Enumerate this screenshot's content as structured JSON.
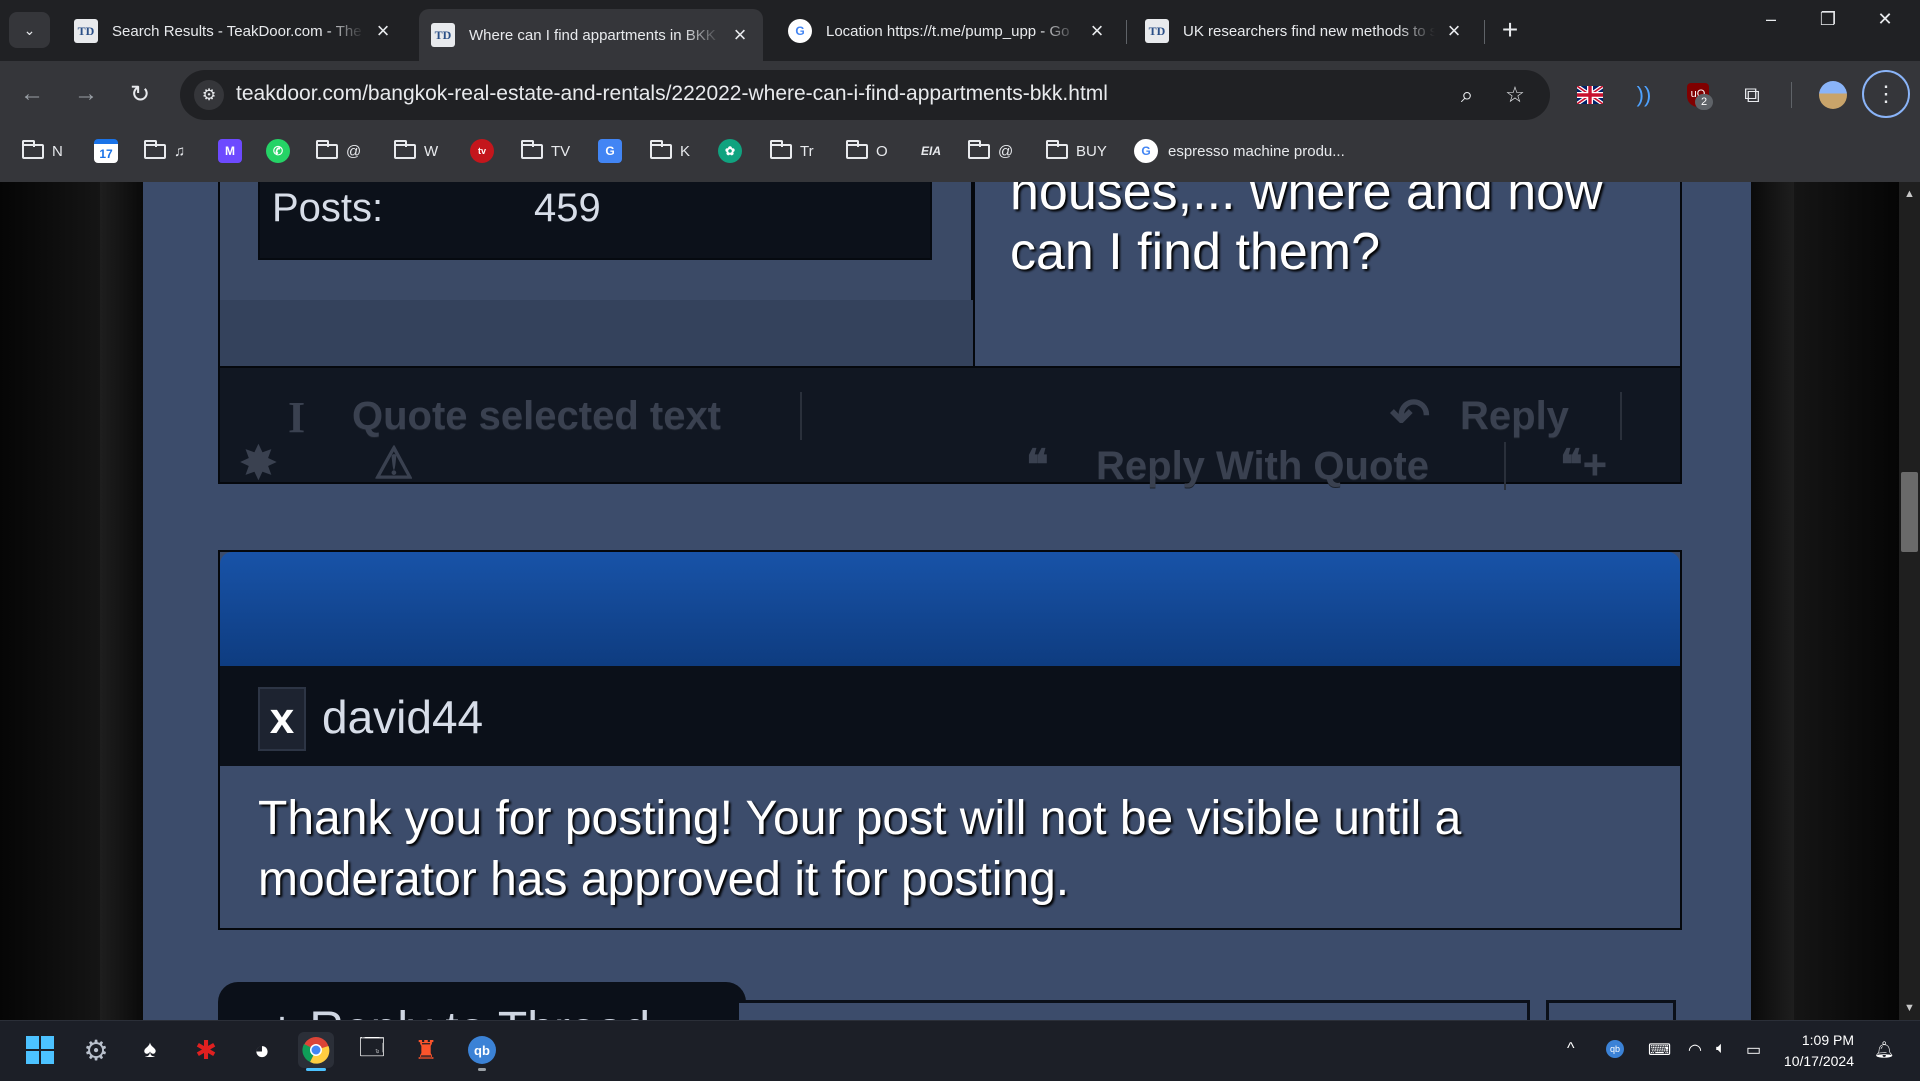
{
  "browser": {
    "tabs": [
      {
        "title": "Search Results - TeakDoor.com - The",
        "favicon": "teakdoor-favicon",
        "active": false
      },
      {
        "title": "Where can I find appartments in BKK ?",
        "favicon": "teakdoor-favicon",
        "active": true
      },
      {
        "title": "Location https://t.me/pump_upp - Go",
        "favicon": "google-favicon",
        "active": false
      },
      {
        "title": "UK researchers find new methods to s",
        "favicon": "teakdoor-favicon",
        "active": false
      }
    ],
    "url": "teakdoor.com/bangkok-real-estate-and-rentals/222022-where-can-i-find-appartments-bkk.html",
    "extension_badge": "2",
    "bookmarks": [
      {
        "label": "N",
        "icon": "folder-icon"
      },
      {
        "label": "",
        "icon": "calendar-icon",
        "text": "17"
      },
      {
        "label": "♫",
        "icon": "folder-icon"
      },
      {
        "label": "",
        "icon": "proton-mail-icon"
      },
      {
        "label": "",
        "icon": "whatsapp-icon"
      },
      {
        "label": "@",
        "icon": "folder-icon"
      },
      {
        "label": "W",
        "icon": "folder-icon"
      },
      {
        "label": "",
        "icon": "tv-icon"
      },
      {
        "label": "TV",
        "icon": "folder-icon"
      },
      {
        "label": "",
        "icon": "google-translate-icon"
      },
      {
        "label": "K",
        "icon": "folder-icon"
      },
      {
        "label": "",
        "icon": "chatgpt-icon"
      },
      {
        "label": "Tr",
        "icon": "folder-icon"
      },
      {
        "label": "O",
        "icon": "folder-icon"
      },
      {
        "label": "",
        "icon": "eia-icon",
        "text": "EIA"
      },
      {
        "label": "@",
        "icon": "folder-icon"
      },
      {
        "label": "BUY",
        "icon": "folder-icon"
      },
      {
        "label": "espresso machine produ...",
        "icon": "google-icon"
      }
    ]
  },
  "forum": {
    "posts_label": "Posts:",
    "posts_count": "459",
    "post_title": "houses,... where and how can I find them?",
    "actions": {
      "quote_selected": "Quote selected text",
      "reply": "Reply",
      "reply_with_quote": "Reply With Quote"
    },
    "pending_post": {
      "avatar_letter": "x",
      "username": "david44",
      "message": "Thank you for posting! Your post will not be visible until a moderator has approved it for posting."
    },
    "bottom_tab_partial": "+ Reply to Thread"
  },
  "taskbar": {
    "time": "1:09 PM",
    "date": "10/17/2024"
  },
  "colors": {
    "page_bg": "#3c4c6b",
    "header_blue": "#0e3c80",
    "dark_panel": "#111722"
  }
}
